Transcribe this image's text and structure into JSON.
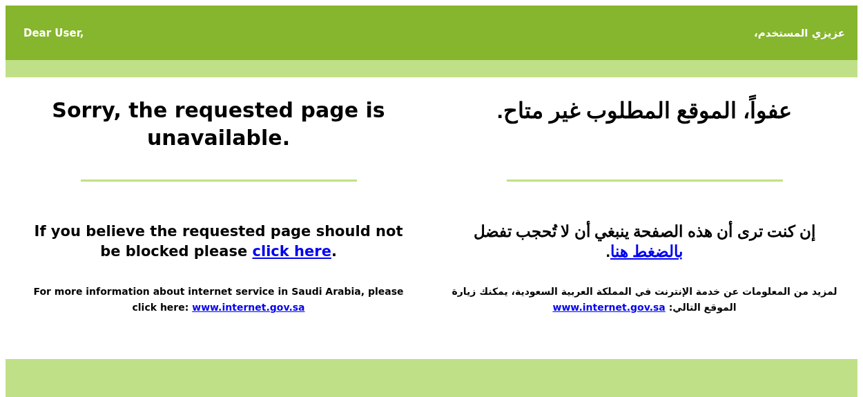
{
  "header": {
    "greeting_en": "Dear User,",
    "greeting_ar": "عزيزي المستخدم،"
  },
  "english": {
    "title": "Sorry, the requested page is unavailable.",
    "message": "If you believe the requested page should not be blocked please ",
    "message_link": "click here",
    "message_end": ".",
    "info": "For more information about internet service in Saudi Arabia, please click here: ",
    "info_link": "www.internet.gov.sa"
  },
  "arabic": {
    "title": "عفواً، الموقع المطلوب غير متاح.",
    "message": "إن كنت ترى أن هذه الصفحة ينبغي أن لا تُحجب تفضل ",
    "message_link": "بالضغط هنا",
    "message_end": ".",
    "info": "لمزيد من المعلومات عن خدمة الإنترنت في المملكة العربية السعودية، يمكنك زيارة الموقع التالي: ",
    "info_link": "www.internet.gov.sa"
  }
}
